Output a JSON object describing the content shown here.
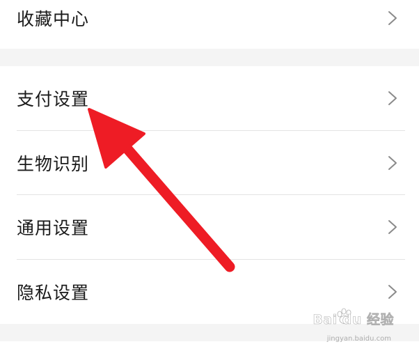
{
  "settings": {
    "top_item": {
      "label": "收藏中心"
    },
    "items": [
      {
        "label": "支付设置"
      },
      {
        "label": "生物识别"
      },
      {
        "label": "通用设置"
      },
      {
        "label": "隐私设置"
      }
    ]
  },
  "annotation": {
    "arrow_color": "#ee1c25",
    "points_to": "支付设置"
  },
  "watermark": {
    "brand": "Bai du 经验",
    "url": "jingyan.baidu.com"
  },
  "icons": {
    "chevron": "chevron-right-icon",
    "watermark_logo": "baidu-paw-icon"
  }
}
